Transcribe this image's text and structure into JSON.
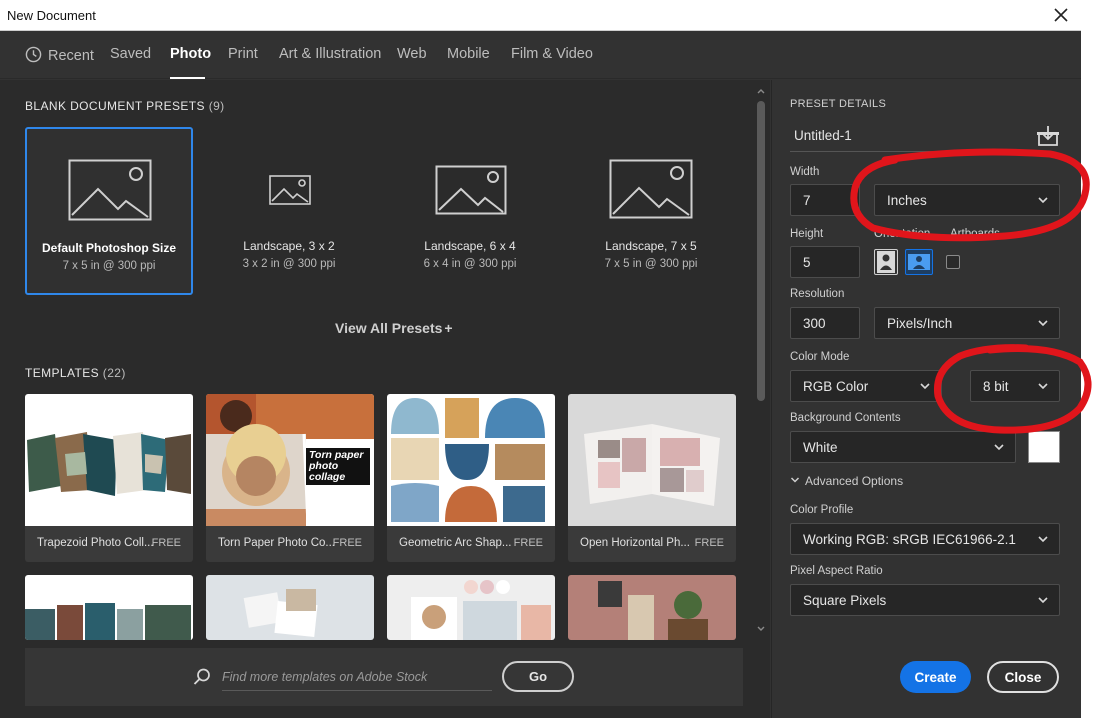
{
  "window": {
    "title": "New Document"
  },
  "tabs": [
    {
      "label": "Recent"
    },
    {
      "label": "Saved"
    },
    {
      "label": "Photo"
    },
    {
      "label": "Print"
    },
    {
      "label": "Art & Illustration"
    },
    {
      "label": "Web"
    },
    {
      "label": "Mobile"
    },
    {
      "label": "Film & Video"
    }
  ],
  "presets_section": {
    "label": "BLANK DOCUMENT PRESETS",
    "count": "(9)"
  },
  "presets": [
    {
      "name": "Default Photoshop Size",
      "size": "7 x 5 in @ 300 ppi",
      "selected": true
    },
    {
      "name": "Landscape, 3 x 2",
      "size": "3 x 2 in @ 300 ppi"
    },
    {
      "name": "Landscape, 6 x 4",
      "size": "6 x 4 in @ 300 ppi"
    },
    {
      "name": "Landscape, 7 x 5",
      "size": "7 x 5 in @ 300 ppi"
    }
  ],
  "view_all": "View All Presets",
  "templates_section": {
    "label": "TEMPLATES",
    "count": "(22)"
  },
  "templates": [
    {
      "name": "Trapezoid Photo Coll...",
      "badge": "FREE"
    },
    {
      "name": "Torn Paper Photo Co...",
      "badge": "FREE",
      "thumb_text": "Torn paper photo collage"
    },
    {
      "name": "Geometric Arc Shap...",
      "badge": "FREE"
    },
    {
      "name": "Open Horizontal Ph...",
      "badge": "FREE"
    }
  ],
  "search": {
    "placeholder": "Find more templates on Adobe Stock",
    "button": "Go"
  },
  "details": {
    "section_label": "PRESET DETAILS",
    "doc_name": "Untitled-1",
    "width_label": "Width",
    "width_value": "7",
    "width_unit": "Inches",
    "height_label": "Height",
    "height_value": "5",
    "orientation_label": "Orientation",
    "artboards_label": "Artboards",
    "resolution_label": "Resolution",
    "resolution_value": "300",
    "resolution_unit": "Pixels/Inch",
    "color_mode_label": "Color Mode",
    "color_mode": "RGB Color",
    "bit_depth": "8 bit",
    "bg_label": "Background Contents",
    "bg_value": "White",
    "bg_color": "#ffffff",
    "advanced": "Advanced Options",
    "color_profile_label": "Color Profile",
    "color_profile": "Working RGB: sRGB IEC61966-2.1",
    "pixel_aspect_label": "Pixel Aspect Ratio",
    "pixel_aspect": "Square Pixels"
  },
  "actions": {
    "create": "Create",
    "close": "Close"
  },
  "colors": {
    "accent": "#1473e6",
    "selected_border": "#2f87ea",
    "annotation": "#e0151b"
  }
}
